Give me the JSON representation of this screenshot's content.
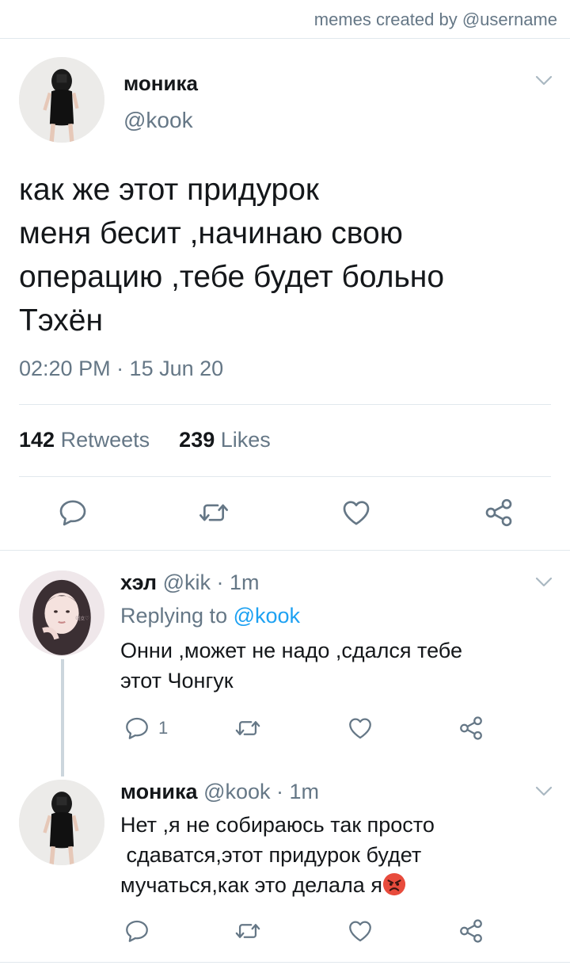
{
  "watermark": "memes created by @username",
  "main_tweet": {
    "author_name": "моника",
    "author_handle": "@kook",
    "text_lines": [
      "как же этот придурок",
      "меня бесит ,начинаю свою",
      "операцию ,тебе будет больно",
      "Тэхён"
    ],
    "timestamp": "02:20 PM · 15 Jun 20",
    "retweets_count": "142",
    "retweets_label": "Retweets",
    "likes_count": "239",
    "likes_label": "Likes"
  },
  "replies": [
    {
      "author_name": "хэл",
      "meta": "@kik · 1m",
      "replying_prefix": "Replying to",
      "replying_mention": "@kook",
      "text_lines": [
        "Онни ,может не надо ,сдался тебе",
        "этот Чонгук"
      ],
      "reply_count": "1"
    },
    {
      "author_name": "моника",
      "meta": "@kook · 1m",
      "text_lines": [
        "Нет ,я не собираюсь так просто",
        " сдаватся,этот придурок будет",
        "мучаться,как это делала я"
      ],
      "emoji": "angry-face-emoji"
    }
  ],
  "icons": {
    "reply": "reply-icon",
    "retweet": "retweet-icon",
    "like": "heart-icon",
    "share": "share-icon",
    "menu": "chevron-down-icon"
  },
  "colors": {
    "text": "#14171a",
    "secondary": "#657786",
    "link": "#1da1f2",
    "border": "#e1e8ed",
    "thread": "#ccd6dd"
  }
}
